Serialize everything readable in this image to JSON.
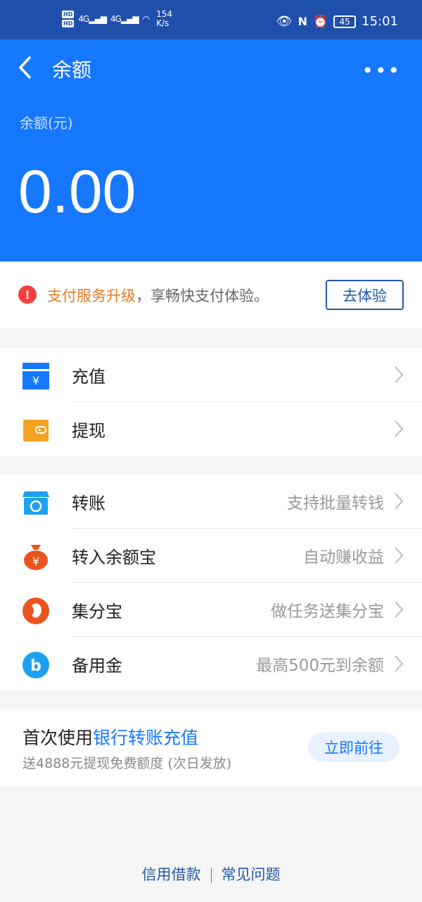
{
  "status_bar": {
    "hd1": "HD",
    "hd2": "HD",
    "signal": "4G",
    "speed_value": "154",
    "speed_unit": "K/s",
    "battery": "45",
    "time": "15:01"
  },
  "header": {
    "title": "余额",
    "balance_label": "余额(元)",
    "balance": "0.00",
    "bg_color": "#1677ff"
  },
  "notice": {
    "highlight": "支付服务升级",
    "text": "，享畅快支付体验。",
    "button": "去体验"
  },
  "group1": [
    {
      "label": "充值",
      "sub": "",
      "icon": "recharge-icon"
    },
    {
      "label": "提现",
      "sub": "",
      "icon": "wallet-icon"
    }
  ],
  "group2": [
    {
      "label": "转账",
      "sub": "支持批量转钱",
      "icon": "transfer-store-icon"
    },
    {
      "label": "转入余额宝",
      "sub": "自动赚收益",
      "icon": "money-bag-icon"
    },
    {
      "label": "集分宝",
      "sub": "做任务送集分宝",
      "icon": "jifenbao-icon"
    },
    {
      "label": "备用金",
      "sub": "最高500元到余额",
      "icon": "reserve-fund-icon"
    }
  ],
  "promo": {
    "title_prefix": "首次使用",
    "title_link": "银行转账充值",
    "subtitle": "送4888元提现免费额度 (次日发放)",
    "button": "立即前往"
  },
  "footer": {
    "link1": "信用借款",
    "link2": "常见问题"
  }
}
